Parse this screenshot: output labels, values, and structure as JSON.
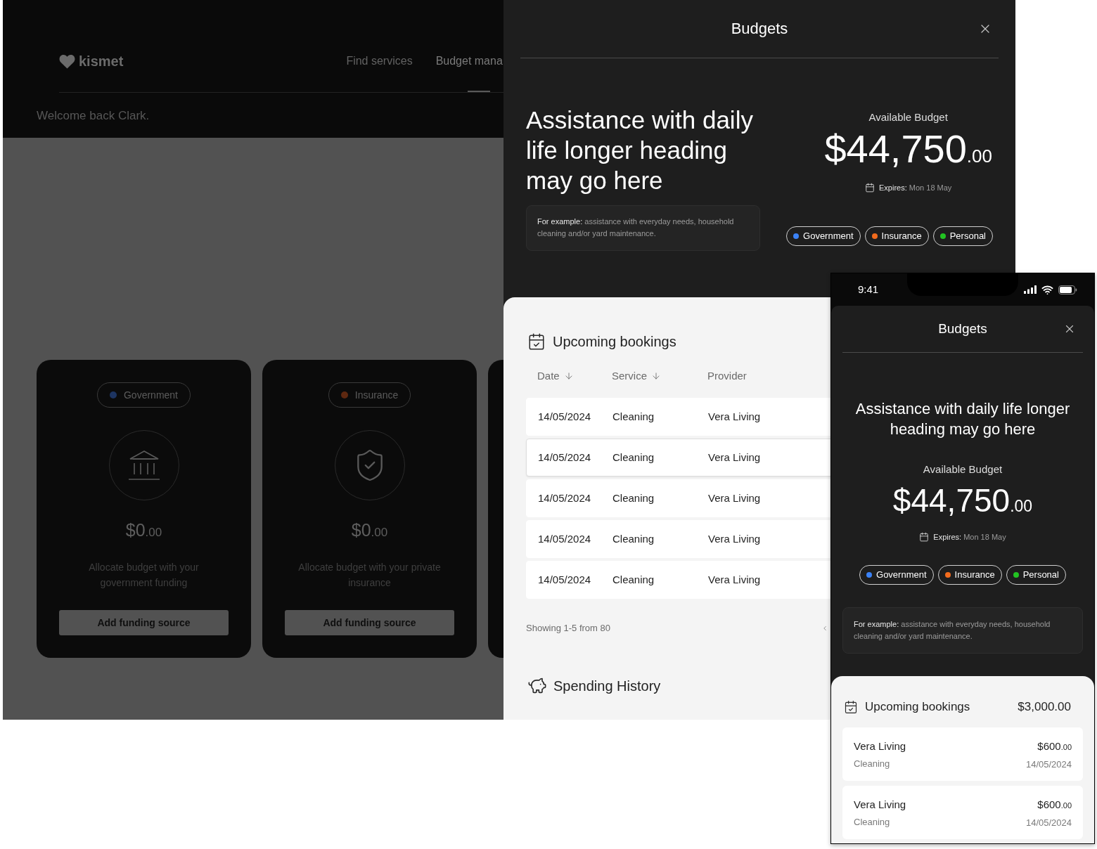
{
  "desktop": {
    "header": {
      "logo": "kismet",
      "nav": [
        {
          "label": "Find services",
          "selected": false
        },
        {
          "label": "Budget mana",
          "selected": true
        }
      ],
      "welcome": "Welcome back Clark."
    },
    "funding_cards": [
      {
        "kind": "government",
        "tag": "Government",
        "color": "#1d3461",
        "amount": "$0",
        "cents": ".00",
        "description": "Allocate budget with your government funding",
        "button": "Add funding source"
      },
      {
        "kind": "insurance",
        "tag": "Insurance",
        "color": "#5e2810",
        "amount": "$0",
        "cents": ".00",
        "description": "Allocate budget with your private insurance",
        "button": "Add funding source"
      }
    ],
    "drawer": {
      "title": "Budgets",
      "heading": "Assistance with daily life longer heading may go here",
      "example_label": "For example:",
      "example_text": "assistance with everyday needs, household cleaning and/or yard maintenance.",
      "available_label": "Available Budget",
      "amount": "$44,750",
      "cents": ".00",
      "expires_label": "Expires:",
      "expires_value": "Mon 18 May",
      "sources": [
        {
          "label": "Government",
          "color": "#3b82f6"
        },
        {
          "label": "Insurance",
          "color": "#f26b1d"
        },
        {
          "label": "Personal",
          "color": "#22c322"
        }
      ],
      "upcoming": {
        "title": "Upcoming bookings",
        "columns": [
          {
            "label": "Date",
            "sorted": true
          },
          {
            "label": "Service",
            "sorted": true
          },
          {
            "label": "Provider",
            "sorted": false
          }
        ],
        "rows": [
          {
            "date": "14/05/2024",
            "service": "Cleaning",
            "provider": "Vera Living",
            "selected": false
          },
          {
            "date": "14/05/2024",
            "service": "Cleaning",
            "provider": "Vera Living",
            "selected": true
          },
          {
            "date": "14/05/2024",
            "service": "Cleaning",
            "provider": "Vera Living",
            "selected": false
          },
          {
            "date": "14/05/2024",
            "service": "Cleaning",
            "provider": "Vera Living",
            "selected": false
          },
          {
            "date": "14/05/2024",
            "service": "Cleaning",
            "provider": "Vera Living",
            "selected": false
          }
        ],
        "showing": "Showing 1-5 from 80"
      },
      "spending": {
        "title": "Spending History"
      }
    }
  },
  "mobile": {
    "time": "9:41",
    "title": "Budgets",
    "heading": "Assistance with daily life longer heading may go here",
    "available_label": "Available Budget",
    "amount": "$44,750",
    "cents": ".00",
    "expires_label": "Expires:",
    "expires_value": "Mon 18 May",
    "sources": [
      {
        "label": "Government",
        "color": "#3b82f6"
      },
      {
        "label": "Insurance",
        "color": "#f26b1d"
      },
      {
        "label": "Personal",
        "color": "#22c322"
      }
    ],
    "example_label": "For example:",
    "example_text": "assistance with everyday needs, household cleaning and/or yard maintenance.",
    "upcoming": {
      "title": "Upcoming bookings",
      "total": "$3,000.00",
      "items": [
        {
          "provider": "Vera Living",
          "service": "Cleaning",
          "amount": "$600",
          "cents": ".00",
          "date": "14/05/2024"
        },
        {
          "provider": "Vera Living",
          "service": "Cleaning",
          "amount": "$600",
          "cents": ".00",
          "date": "14/05/2024"
        }
      ]
    }
  }
}
